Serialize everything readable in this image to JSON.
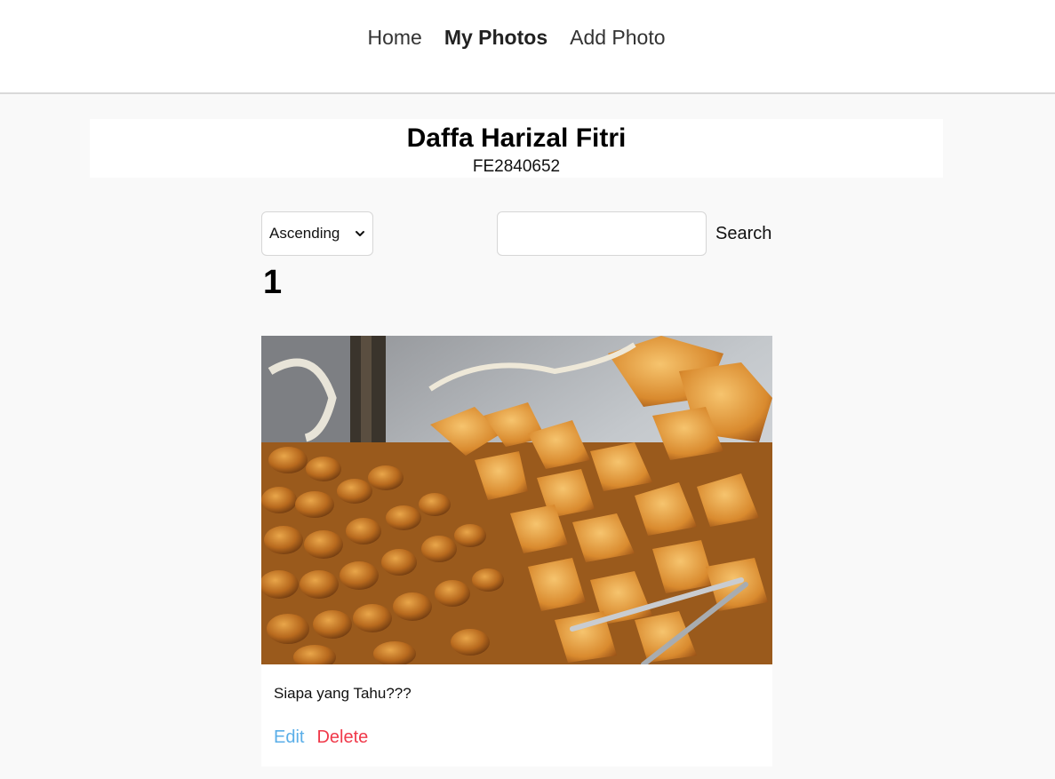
{
  "nav": {
    "home": "Home",
    "my_photos": "My Photos",
    "add_photo": "Add Photo"
  },
  "profile": {
    "name": "Daffa Harizal Fitri",
    "id": "FE2840652"
  },
  "controls": {
    "sort_selected": "Ascending",
    "search_value": "",
    "search_label": "Search"
  },
  "count": "1",
  "photos": [
    {
      "caption": "Siapa yang Tahu???",
      "edit_label": "Edit",
      "delete_label": "Delete"
    }
  ],
  "colors": {
    "edit": "#5aaee8",
    "delete": "#f0394a",
    "background": "#f9f9f9"
  },
  "icons": {
    "sort_dropdown": "chevron-down-icon"
  }
}
